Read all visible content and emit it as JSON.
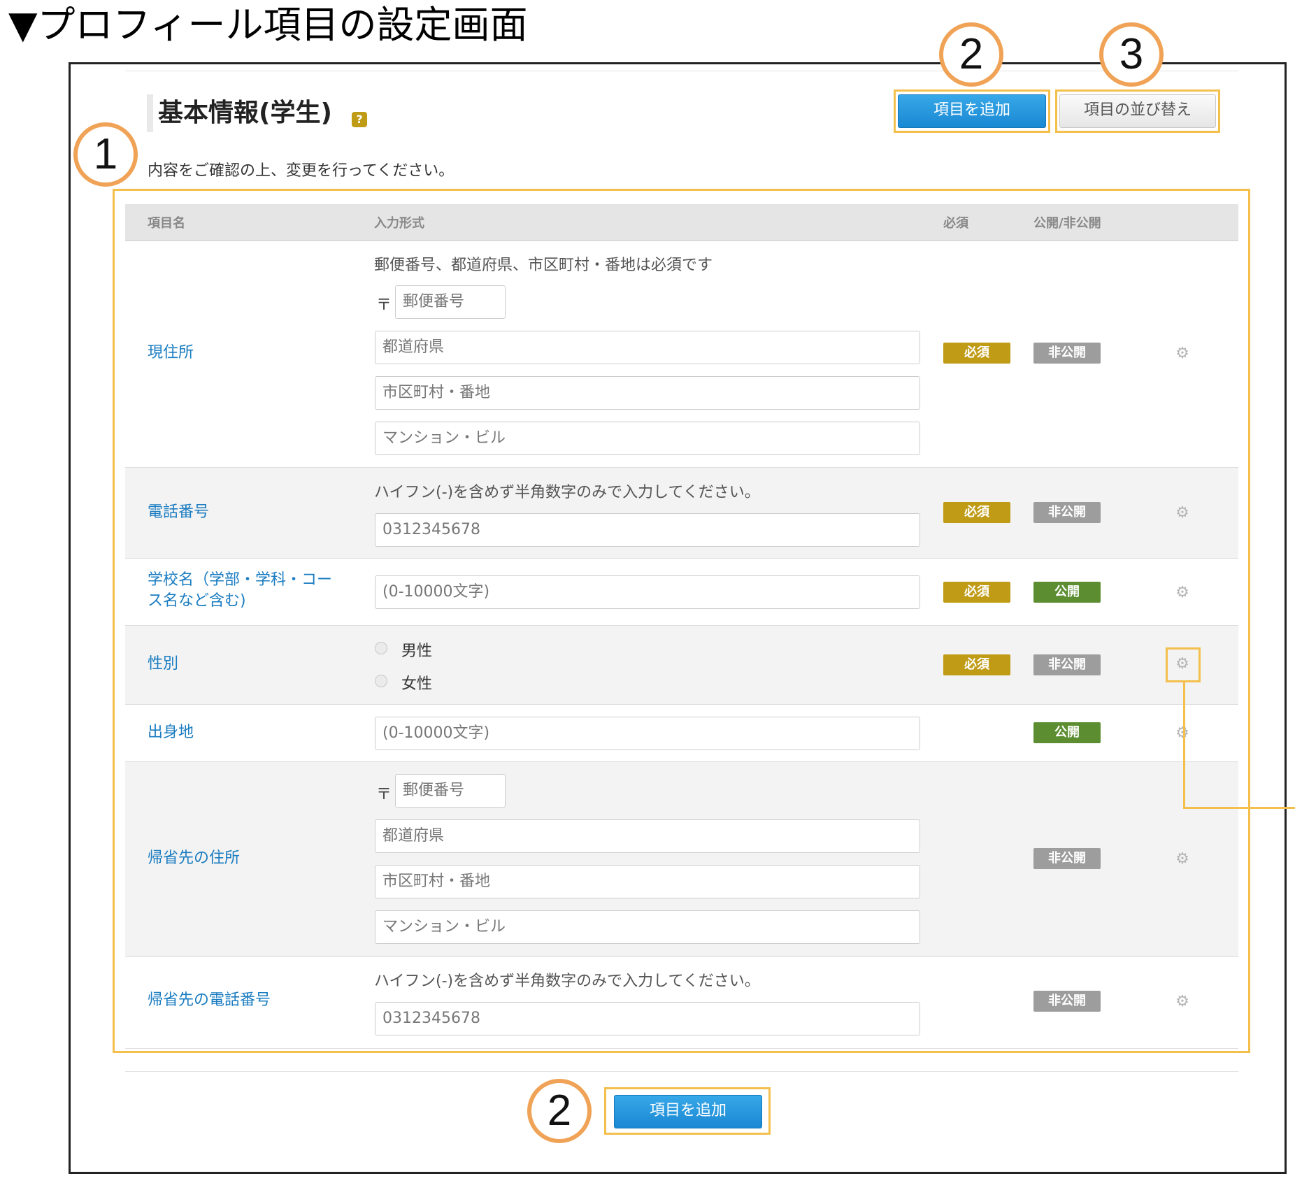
{
  "caption": "▼プロフィール項目の設定画面",
  "header": {
    "title": "基本情報(学生)",
    "help_icon": "?",
    "intro": "内容をご確認の上、変更を行ってください。"
  },
  "buttons": {
    "add_item": "項目を追加",
    "sort_items": "項目の並び替え"
  },
  "callouts": [
    "1",
    "2",
    "3"
  ],
  "table": {
    "columns": [
      "項目名",
      "入力形式",
      "必須",
      "公開/非公開"
    ],
    "rows": [
      {
        "name": "現住所",
        "hint": "郵便番号、都道府県、市区町村・番地は必須です",
        "postal_mark": "〒",
        "postal_placeholder": "郵便番号",
        "fields": [
          "都道府県",
          "市区町村・番地",
          "マンション・ビル"
        ],
        "required": "必須",
        "visibility": "非公開"
      },
      {
        "name": "電話番号",
        "hint": "ハイフン(-)を含めず半角数字のみで入力してください。",
        "placeholder": "0312345678",
        "required": "必須",
        "visibility": "非公開"
      },
      {
        "name_line1": "学校名（学部・学科・コー",
        "name_line2": "ス名など含む)",
        "placeholder": "(0-10000文字)",
        "required": "必須",
        "visibility": "公開"
      },
      {
        "name": "性別",
        "options": [
          "男性",
          "女性"
        ],
        "required": "必須",
        "visibility": "非公開"
      },
      {
        "name": "出身地",
        "placeholder": "(0-10000文字)",
        "visibility": "公開"
      },
      {
        "name": "帰省先の住所",
        "postal_mark": "〒",
        "postal_placeholder": "郵便番号",
        "fields": [
          "都道府県",
          "市区町村・番地",
          "マンション・ビル"
        ],
        "visibility": "非公開"
      },
      {
        "name": "帰省先の電話番号",
        "hint": "ハイフン(-)を含めず半角数字のみで入力してください。",
        "placeholder": "0312345678",
        "visibility": "非公開"
      }
    ]
  },
  "icons": {
    "gear": "gear-icon",
    "help": "help-icon"
  },
  "colors": {
    "required_badge": "#bf9b16",
    "private_badge": "#9d9d9d",
    "public_badge": "#5c8e31",
    "primary_button": "#1a88d3",
    "highlight": "#f4c04d",
    "callout": "#f0a356",
    "link": "#1a7cc1"
  }
}
